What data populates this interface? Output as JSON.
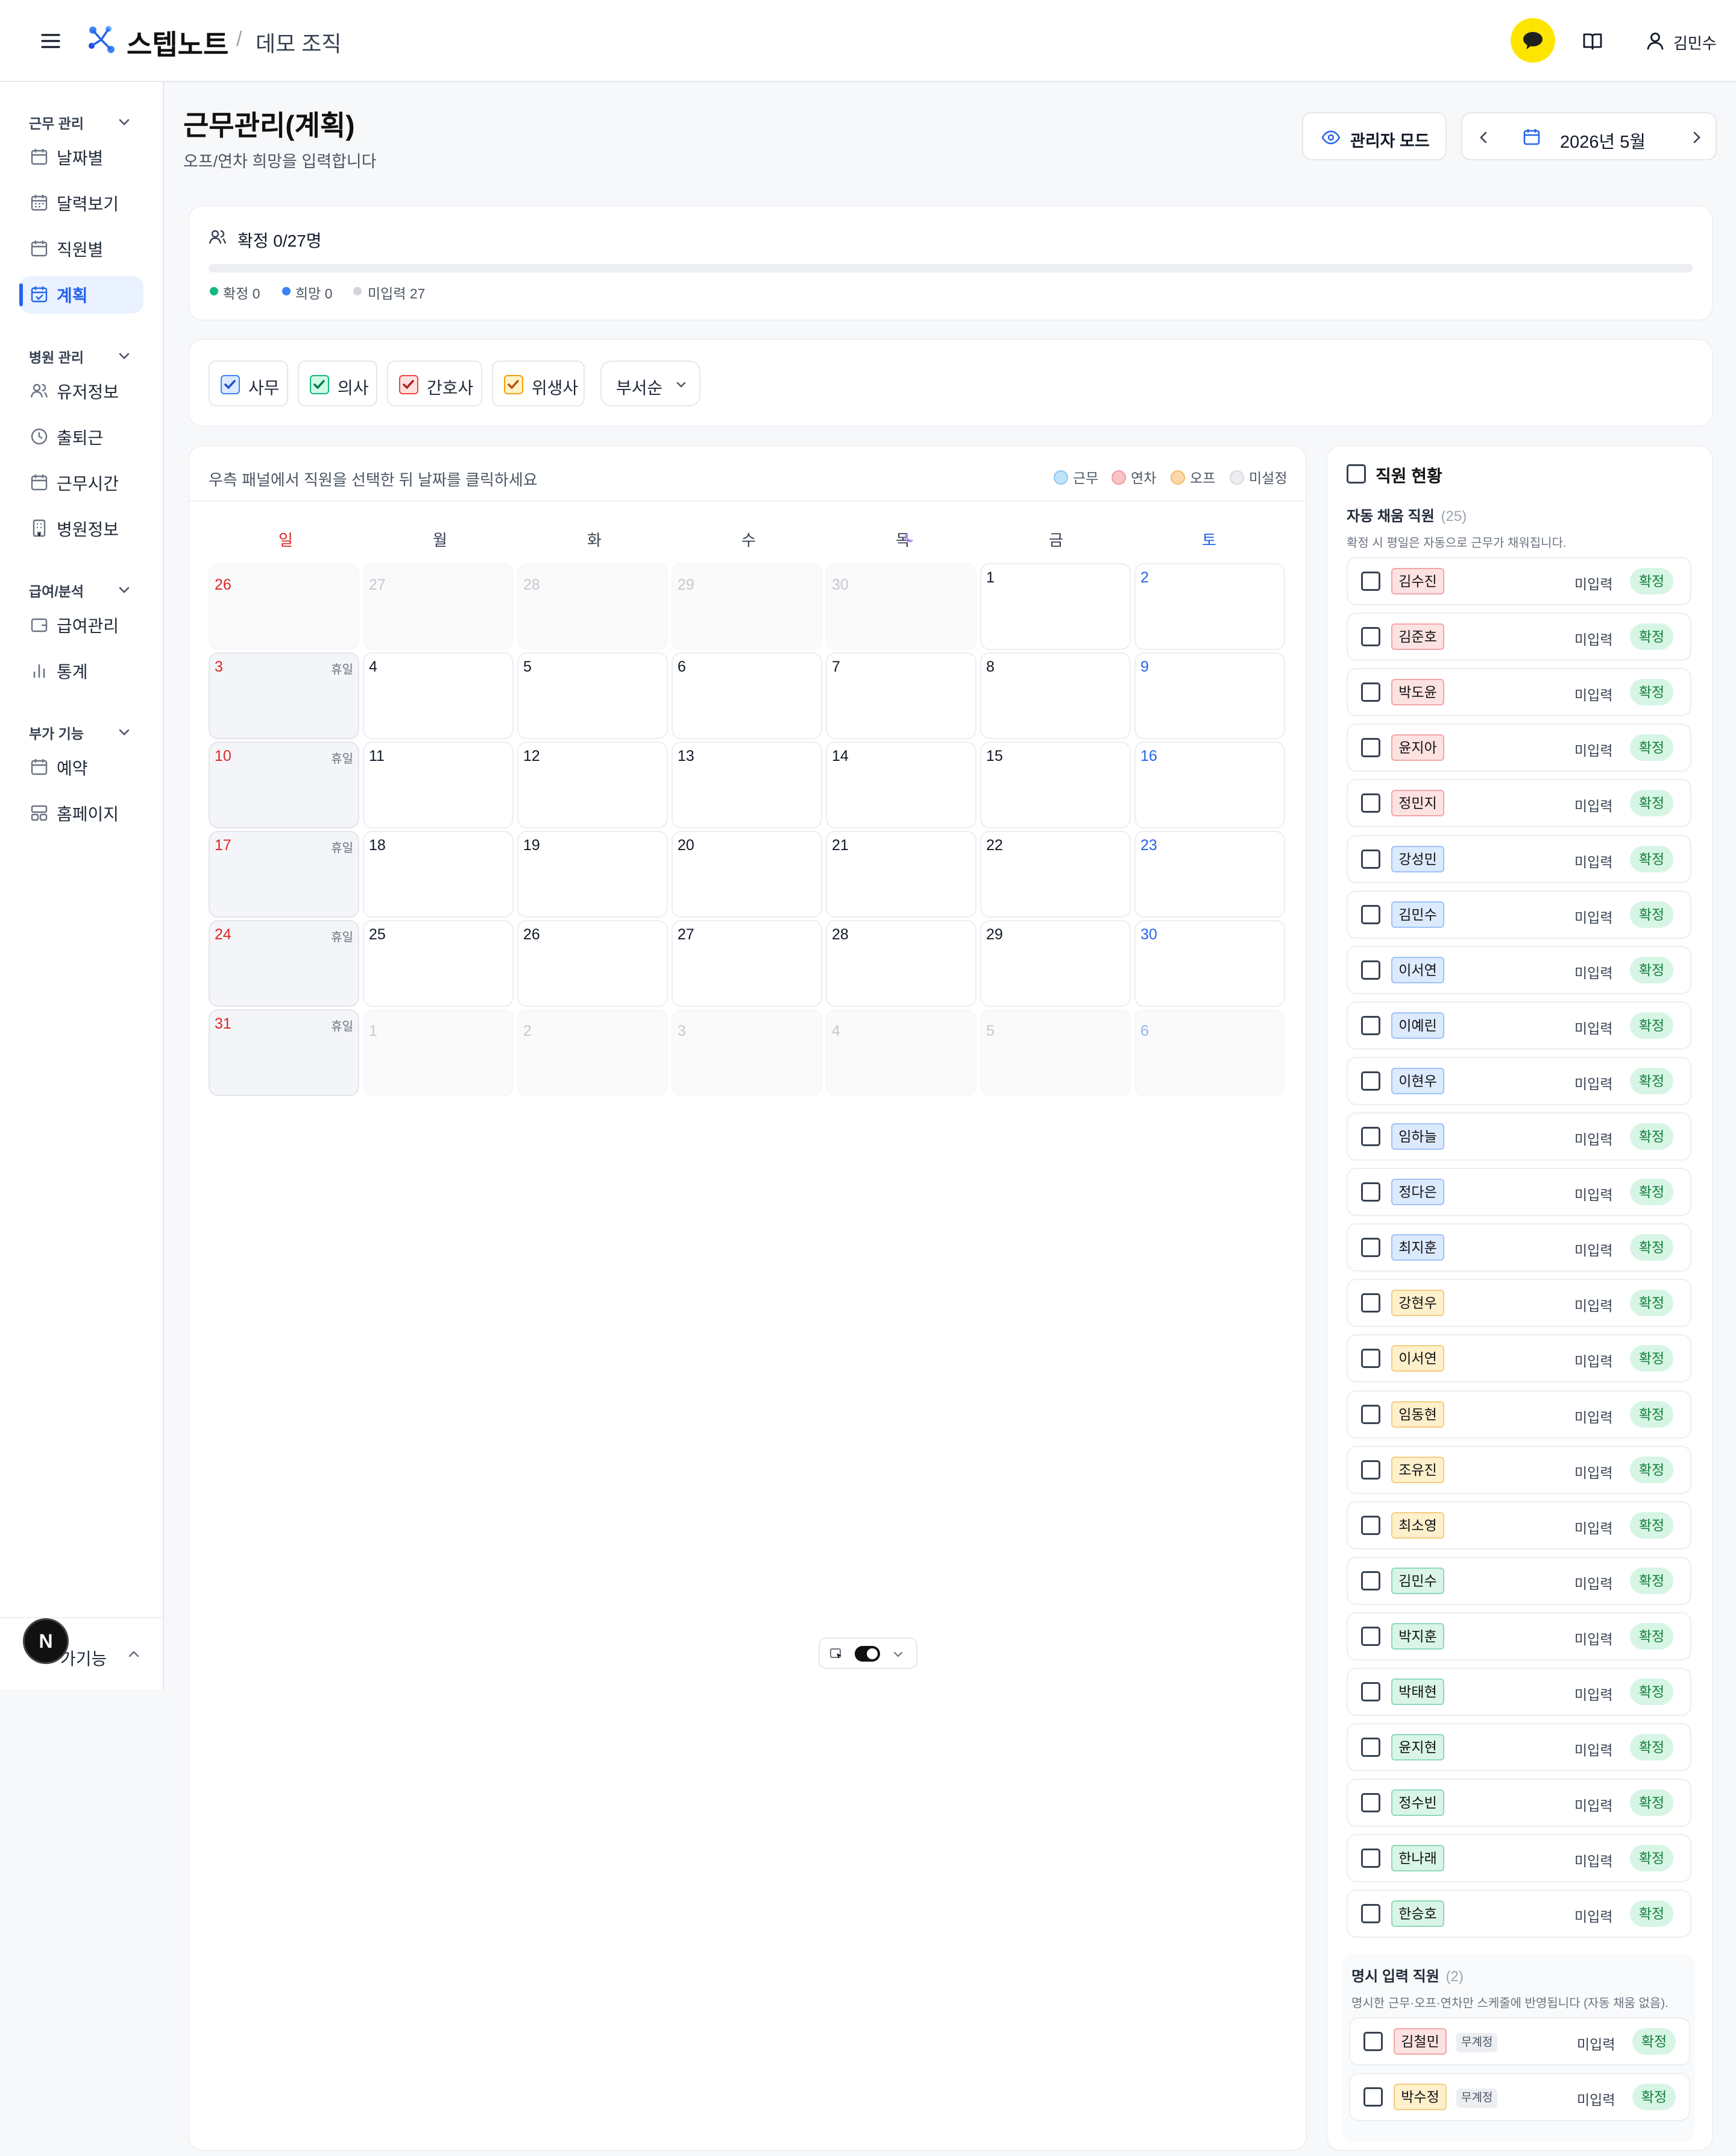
{
  "header": {
    "brand": "스텝노트",
    "separator": "/",
    "org": "데모 조직",
    "user": "김민수"
  },
  "sidebar": {
    "sections": [
      {
        "title": "근무 관리",
        "items": [
          "날짜별",
          "달력보기",
          "직원별",
          "계획"
        ]
      },
      {
        "title": "병원 관리",
        "items": [
          "유저정보",
          "출퇴근",
          "근무시간",
          "병원정보"
        ]
      },
      {
        "title": "급여/분석",
        "items": [
          "급여관리",
          "통계"
        ]
      },
      {
        "title": "부가 기능",
        "items": [
          "예약",
          "홈페이지"
        ]
      }
    ],
    "active": "계획",
    "bottom_label": "가기능",
    "n_badge": "N"
  },
  "page": {
    "title": "근무관리(계획)",
    "subtitle": "오프/연차 희망을 입력합니다",
    "admin_mode": "관리자 모드",
    "month": "2026년 5월"
  },
  "summary": {
    "title": "확정 0/27명",
    "confirmed": "확정 0",
    "hope": "희망 0",
    "not_entered": "미입력 27",
    "progress": 0,
    "colors": {
      "confirmed": "#10b981",
      "hope": "#3b82f6",
      "not_entered": "#d1d5db"
    }
  },
  "filters": {
    "chips": [
      {
        "label": "사무",
        "color": "#3b82f6",
        "checked": true
      },
      {
        "label": "의사",
        "color": "#10b981",
        "checked": true
      },
      {
        "label": "간호사",
        "color": "#ef4444",
        "checked": true
      },
      {
        "label": "위생사",
        "color": "#f59e0b",
        "checked": true
      }
    ],
    "sort": "부서순"
  },
  "calendar": {
    "instruction": "우측 패널에서 직원을 선택한 뒤 날짜를 클릭하세요",
    "legend": [
      "근무",
      "연차",
      "오프",
      "미설정"
    ],
    "legend_colors": [
      "#bfe3fb",
      "#fbc4c4",
      "#fcd9a8",
      "#eceef1"
    ],
    "weekdays": [
      "일",
      "월",
      "화",
      "수",
      "목",
      "금",
      "토"
    ],
    "holiday_label": "휴일",
    "weeks": [
      [
        "26",
        "27",
        "28",
        "29",
        "30",
        "1",
        "2"
      ],
      [
        "3",
        "4",
        "5",
        "6",
        "7",
        "8",
        "9"
      ],
      [
        "10",
        "11",
        "12",
        "13",
        "14",
        "15",
        "16"
      ],
      [
        "17",
        "18",
        "19",
        "20",
        "21",
        "22",
        "23"
      ],
      [
        "24",
        "25",
        "26",
        "27",
        "28",
        "29",
        "30"
      ],
      [
        "31",
        "1",
        "2",
        "3",
        "4",
        "5",
        "6"
      ]
    ]
  },
  "panel": {
    "title": "직원 현황",
    "auto_title": "자동 채움 직원",
    "auto_count": "(25)",
    "auto_desc": "확정 시 평일은 자동으로 근무가 채워집니다.",
    "status_label": "미입력",
    "confirm_label": "확정",
    "auto_staff": [
      {
        "name": "김수진",
        "color": "red"
      },
      {
        "name": "김준호",
        "color": "red"
      },
      {
        "name": "박도윤",
        "color": "red"
      },
      {
        "name": "윤지아",
        "color": "red"
      },
      {
        "name": "정민지",
        "color": "red"
      },
      {
        "name": "강성민",
        "color": "blue"
      },
      {
        "name": "김민수",
        "color": "blue"
      },
      {
        "name": "이서연",
        "color": "blue"
      },
      {
        "name": "이예린",
        "color": "blue"
      },
      {
        "name": "이현우",
        "color": "blue"
      },
      {
        "name": "임하늘",
        "color": "blue"
      },
      {
        "name": "정다은",
        "color": "blue"
      },
      {
        "name": "최지훈",
        "color": "blue"
      },
      {
        "name": "강현우",
        "color": "yellow"
      },
      {
        "name": "이서연",
        "color": "yellow"
      },
      {
        "name": "임동현",
        "color": "yellow"
      },
      {
        "name": "조유진",
        "color": "yellow"
      },
      {
        "name": "최소영",
        "color": "yellow"
      },
      {
        "name": "김민수",
        "color": "green"
      },
      {
        "name": "박지훈",
        "color": "green"
      },
      {
        "name": "박태현",
        "color": "green"
      },
      {
        "name": "윤지현",
        "color": "green"
      },
      {
        "name": "정수빈",
        "color": "green"
      },
      {
        "name": "한나래",
        "color": "green"
      },
      {
        "name": "한승호",
        "color": "green"
      }
    ],
    "explicit_title": "명시 입력 직원",
    "explicit_count": "(2)",
    "explicit_desc": "명시한 근무·오프·연차만 스케줄에 반영됩니다 (자동 채움 없음).",
    "no_account_label": "무계정",
    "explicit_staff": [
      {
        "name": "김철민",
        "color": "red"
      },
      {
        "name": "박수정",
        "color": "yellow"
      }
    ]
  }
}
